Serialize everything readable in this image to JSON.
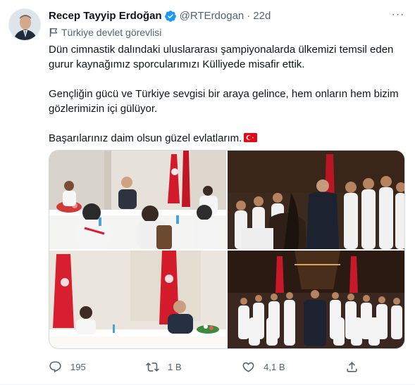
{
  "tweet": {
    "author_name": "Recep Tayyip Erdoğan",
    "handle": "@RTErdogan",
    "separator": "·",
    "time": "22d",
    "more_icon": "more-icon",
    "label": "Türkiye devlet görevlisi",
    "paragraphs": [
      "Dün cimnastik dalındaki uluslararası şampiyonalarda ülkemizi temsil eden gurur kaynağımız sporcularımızı Külliyede misafir ettik.",
      "Gençliğin gücü ve Türkiye sevgisi bir araya gelince, hem onların hem bizim gözlerimizin içi gülüyor.",
      "Başarılarınız daim olsun güzel evlatlarım."
    ],
    "emoji": "turkey-flag-emoji"
  },
  "actions": {
    "reply_count": "195",
    "retweet_count": "1 B",
    "like_count": "4,1 B",
    "share_icon": "share-icon"
  },
  "colors": {
    "verified": "#1d9bf0",
    "text": "#0f1419",
    "secondary": "#536471",
    "flag_red": "#e30a17"
  }
}
